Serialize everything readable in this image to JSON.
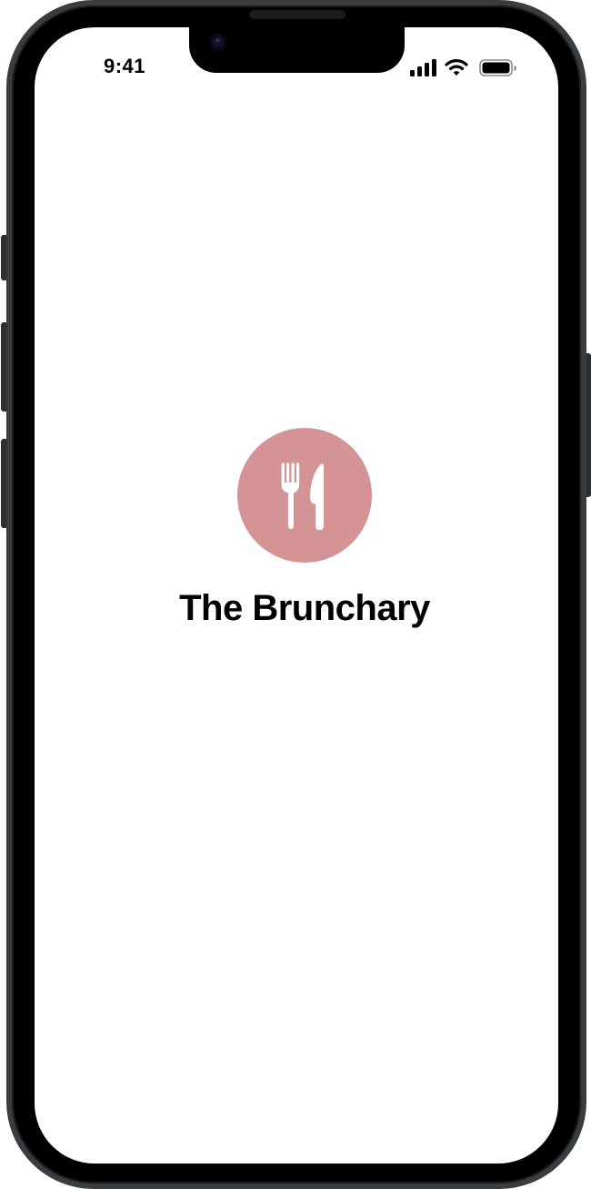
{
  "status_bar": {
    "time": "9:41",
    "icons": [
      "cellular-signal-icon",
      "wifi-icon",
      "battery-icon"
    ]
  },
  "app": {
    "title": "The Brunchary",
    "logo_icon": "fork-knife-icon",
    "logo_color": "#d49394"
  }
}
